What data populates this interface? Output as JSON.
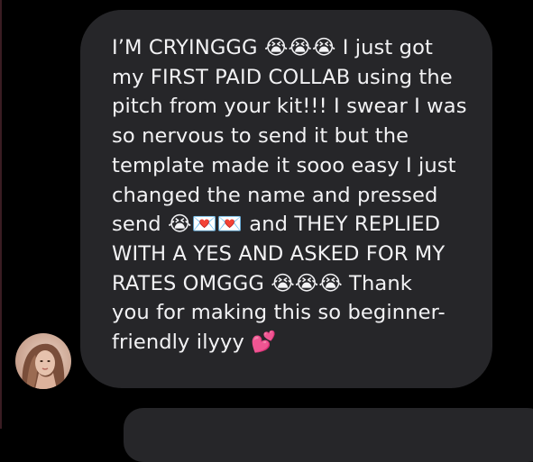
{
  "conversation": {
    "incoming_message": {
      "text": "I’M CRYINGGG 😭😭😭 I just got\nmy FIRST PAID COLLAB using the\npitch from your kit!!! I swear I was\nso nervous to send it but the\ntemplate made it sooo easy I just\nchanged the name and pressed\nsend 😭💌💌 and THEY REPLIED\nWITH A YES AND ASKED FOR MY\nRATES OMGGG 😭😭😭 Thank\nyou for making this so beginner-\nfriendly ilyyy 💕"
    },
    "next_message": {
      "text": ""
    }
  },
  "colors": {
    "background": "#000000",
    "bubble": "#262629",
    "message_text": "#f2f2f4"
  }
}
